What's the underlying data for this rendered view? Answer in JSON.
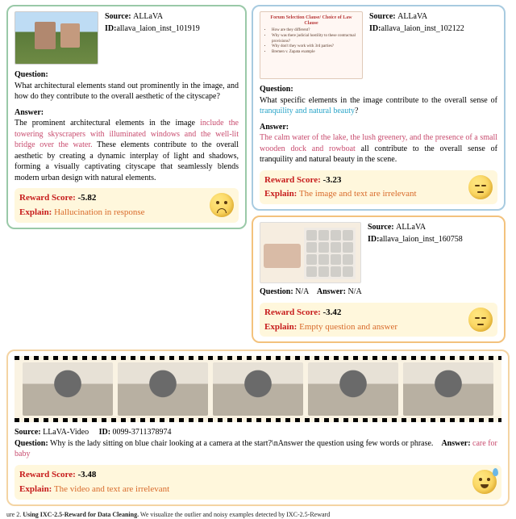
{
  "labels": {
    "source": "Source:",
    "id": "ID:",
    "question": "Question:",
    "answer": "Answer:",
    "reward": "Reward Score:",
    "explain": "Explain:",
    "na": "N/A"
  },
  "panelA": {
    "source": "ALLaVA",
    "id": "allava_laion_inst_101919",
    "question": "What architectural elements stand out prominently in the image, and how do they contribute to the overall aesthetic of the cityscape?",
    "answer_pre": "The prominent architectural elements in the image ",
    "answer_hl": "include the towering skyscrapers with illuminated windows and the well-lit bridge over the water.",
    "answer_post": " These elements contribute to the overall aesthetic by creating a dynamic interplay of light and shadows, forming a visually captivating cityscape that seamlessly blends modern urban design with natural elements.",
    "reward": "-5.82",
    "explain": "Hallucination in response"
  },
  "panelB": {
    "source": "ALLaVA",
    "id": "allava_laion_inst_102122",
    "slide_title": "Forum Selection Clause/ Choice of Law Clause",
    "slide_b1": "How are they different?",
    "slide_b2": "Why was there judicial hostility to these contractual provisions?",
    "slide_b3": "Why don't they work with 3rd parties?",
    "slide_b4": "Bremen v. Zapata example",
    "question_pre": "What specific elements in the image contribute to the overall sense of ",
    "question_hl": "tranquility and natural beauty",
    "question_post": "?",
    "answer_hl": "The calm water of the lake, the lush greenery, and the presence of a small wooden dock and rowboat",
    "answer_post": " all contribute to the overall sense of tranquility and natural beauty in the scene.",
    "reward": "-3.23",
    "explain": "The image and text are irrelevant"
  },
  "panelC": {
    "source": "ALLaVA",
    "id": "allava_laion_inst_160758",
    "reward": "-3.42",
    "explain": "Empty question and answer"
  },
  "panelD": {
    "source": "LLaVA-Video",
    "id": "0099-3711378974",
    "question": "Why is the lady sitting on blue chair looking at a camera at the start?\\nAnswer the question using few words or phrase.",
    "answer_hl": "care for baby",
    "reward": "-3.48",
    "explain": "The video and text are irrelevant"
  },
  "caption_prefix": "ure 2. ",
  "caption_bold": "Using IXC-2.5-Reward for Data Cleaning.",
  "caption_rest": " We visualize the outlier and noisy examples detected by IXC-2.5-Reward"
}
